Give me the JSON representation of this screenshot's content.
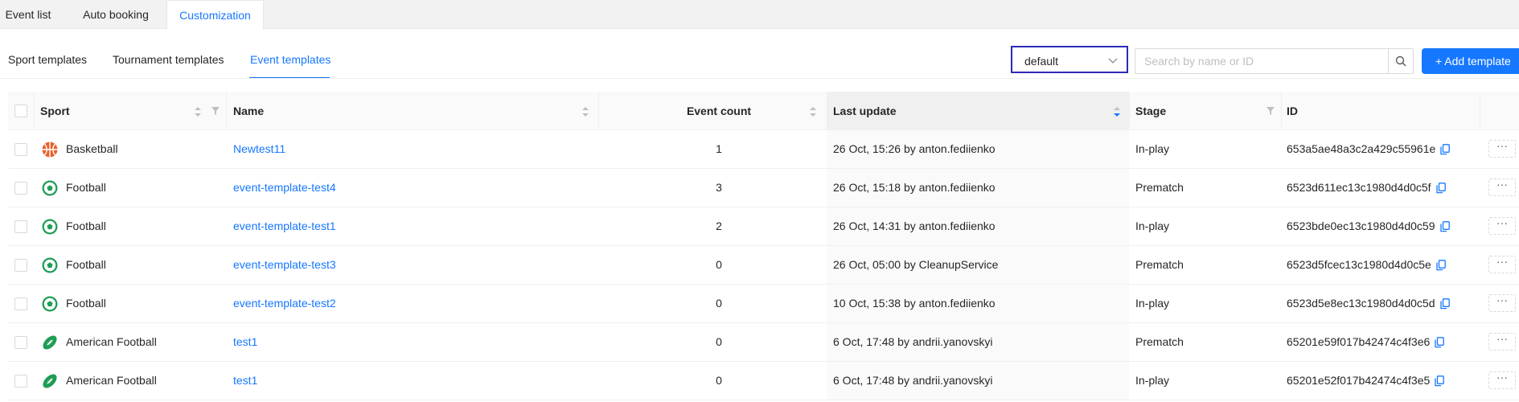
{
  "top_tabs": [
    {
      "label": "Event list"
    },
    {
      "label": "Auto booking"
    },
    {
      "label": "Customization",
      "active": true
    }
  ],
  "sub_tabs": [
    {
      "label": "Sport templates"
    },
    {
      "label": "Tournament templates"
    },
    {
      "label": "Event templates",
      "active": true
    }
  ],
  "toolbar": {
    "select_value": "default",
    "search_placeholder": "Search by name or ID",
    "add_label": "+ Add template"
  },
  "table": {
    "columns": {
      "sport": "Sport",
      "name": "Name",
      "event_count": "Event count",
      "last_update": "Last update",
      "stage": "Stage",
      "id": "ID"
    },
    "sorted_column": "Last update",
    "sort_direction": "descending",
    "rows": [
      {
        "sport": "Basketball",
        "sport_icon": "basketball-icon",
        "name": "Newtest11",
        "event_count": "1",
        "last_update": "26 Oct, 15:26 by anton.fediienko",
        "stage": "In-play",
        "id": "653a5ae48a3c2a429c55961e"
      },
      {
        "sport": "Football",
        "sport_icon": "football-icon",
        "name": "event-template-test4",
        "event_count": "3",
        "last_update": "26 Oct, 15:18 by anton.fediienko",
        "stage": "Prematch",
        "id": "6523d611ec13c1980d4d0c5f"
      },
      {
        "sport": "Football",
        "sport_icon": "football-icon",
        "name": "event-template-test1",
        "event_count": "2",
        "last_update": "26 Oct, 14:31 by anton.fediienko",
        "stage": "In-play",
        "id": "6523bde0ec13c1980d4d0c59"
      },
      {
        "sport": "Football",
        "sport_icon": "football-icon",
        "name": "event-template-test3",
        "event_count": "0",
        "last_update": "26 Oct, 05:00 by CleanupService",
        "stage": "Prematch",
        "id": "6523d5fcec13c1980d4d0c5e"
      },
      {
        "sport": "Football",
        "sport_icon": "football-icon",
        "name": "event-template-test2",
        "event_count": "0",
        "last_update": "10 Oct, 15:38 by anton.fediienko",
        "stage": "In-play",
        "id": "6523d5e8ec13c1980d4d0c5d"
      },
      {
        "sport": "American Football",
        "sport_icon": "american-football-icon",
        "name": "test1",
        "event_count": "0",
        "last_update": "6 Oct, 17:48 by andrii.yanovskyi",
        "stage": "Prematch",
        "id": "65201e59f017b42474c4f3e6"
      },
      {
        "sport": "American Football",
        "sport_icon": "american-football-icon",
        "name": "test1",
        "event_count": "0",
        "last_update": "6 Oct, 17:48 by andrii.yanovskyi",
        "stage": "In-play",
        "id": "65201e52f017b42474c4f3e5"
      }
    ]
  },
  "colors": {
    "accent": "#1677ff",
    "select_border": "#2e2ab7",
    "basketball": "#e8622c",
    "football": "#1f9d55",
    "american_football": "#1f9d55"
  }
}
